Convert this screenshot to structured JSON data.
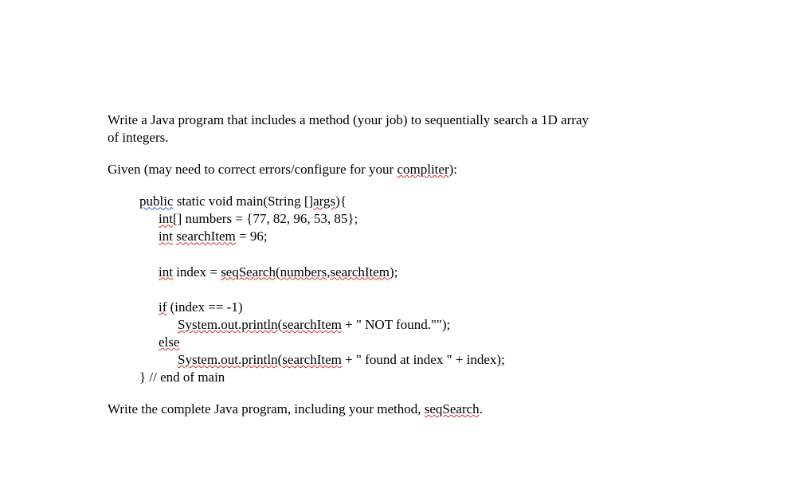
{
  "intro": {
    "line1": "Write a Java program that includes a method (your job) to sequentially search a 1D array",
    "line2": "of integers."
  },
  "given": {
    "prefix": "Given (may need to correct errors/configure for your ",
    "compliter": "compliter",
    "suffix": "):"
  },
  "code": {
    "l1": {
      "public": "public",
      "rest": " static void main(String []",
      "args": "args",
      "tail": "){"
    },
    "l2": {
      "int_arr": "int[]",
      "rest": " numbers = {77, 82, 96, 53, 85};"
    },
    "l3": {
      "int": "int",
      "space": " ",
      "searchItem": "searchItem",
      "rest": " = 96;"
    },
    "l4": {
      "int": "int",
      "rest1": " index = ",
      "seqSearch": "seqSearch",
      "paren": "(",
      "numbers_search": "numbers,searchItem",
      "tail": ");"
    },
    "l5": {
      "if": "if",
      "rest": " (index == -1)"
    },
    "l6": {
      "sys": "System.out.println",
      "paren": "(",
      "searchItem": "searchItem",
      "rest": " + \" NOT found.\"\");"
    },
    "l7": {
      "else": "else"
    },
    "l8": {
      "sys": "System.out.println",
      "paren": "(",
      "searchItem": "searchItem",
      "rest": " + \" found at index \" + index);"
    },
    "l9": {
      "text": "} // end of main"
    }
  },
  "closing": {
    "prefix": "Write the complete Java program, including your method, ",
    "seqSearch": "seqSearch",
    "suffix": "."
  }
}
